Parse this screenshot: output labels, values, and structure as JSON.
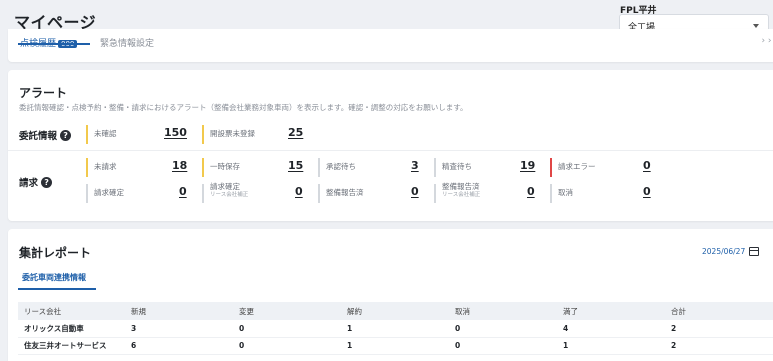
{
  "header": {
    "page_title": "マイページ"
  },
  "factory": {
    "label": "FPL平井",
    "selected": "全工場"
  },
  "top_tabs": {
    "active_label": "点検履歴",
    "active_badge": "000",
    "other_label": "緊急情報設定",
    "right_glyph": "› › ›"
  },
  "alert": {
    "title": "アラート",
    "description": "委託情報確認・点検予約・整備・請求におけるアラート（整備会社業務対象車両）を表示します。確認・調整の対応をお願いします。",
    "itaku": {
      "label": "委託情報",
      "items": [
        {
          "label": "未確認",
          "value": "150",
          "bar": "yellow"
        },
        {
          "label": "開設票未登録",
          "value": "25",
          "bar": "yellow"
        }
      ]
    },
    "seikyu": {
      "label": "請求",
      "row1": [
        {
          "label": "未請求",
          "value": "18",
          "bar": "yellow"
        },
        {
          "label": "一時保存",
          "value": "15",
          "bar": "yellow"
        },
        {
          "label": "承認待ち",
          "value": "3",
          "bar": "grey"
        },
        {
          "label": "精査待ち",
          "value": "19",
          "bar": "grey"
        },
        {
          "label": "請求エラー",
          "value": "0",
          "bar": "red"
        }
      ],
      "row2": [
        {
          "label": "請求確定",
          "sub": "",
          "value": "0",
          "bar": "grey"
        },
        {
          "label": "請求確定",
          "sub": "リース会社補正",
          "value": "0",
          "bar": "grey"
        },
        {
          "label": "整備報告済",
          "sub": "",
          "value": "0",
          "bar": "grey"
        },
        {
          "label": "整備報告済",
          "sub": "リース会社補正",
          "value": "0",
          "bar": "grey"
        },
        {
          "label": "取消",
          "sub": "",
          "value": "0",
          "bar": "grey"
        }
      ]
    }
  },
  "report": {
    "title": "集計レポート",
    "date": "2025/06/27",
    "tab_label": "委託車両連携情報",
    "columns": [
      "リース会社",
      "新規",
      "変更",
      "解約",
      "取消",
      "満了",
      "合計"
    ],
    "rows": [
      [
        "オリックス自動車",
        "3",
        "0",
        "1",
        "0",
        "4",
        "2"
      ],
      [
        "住友三井オートサービス",
        "6",
        "0",
        "1",
        "0",
        "1",
        "2"
      ]
    ]
  },
  "colors": {
    "accent": "#1e5fa9",
    "warning": "#f2c94c",
    "error": "#e04646"
  }
}
